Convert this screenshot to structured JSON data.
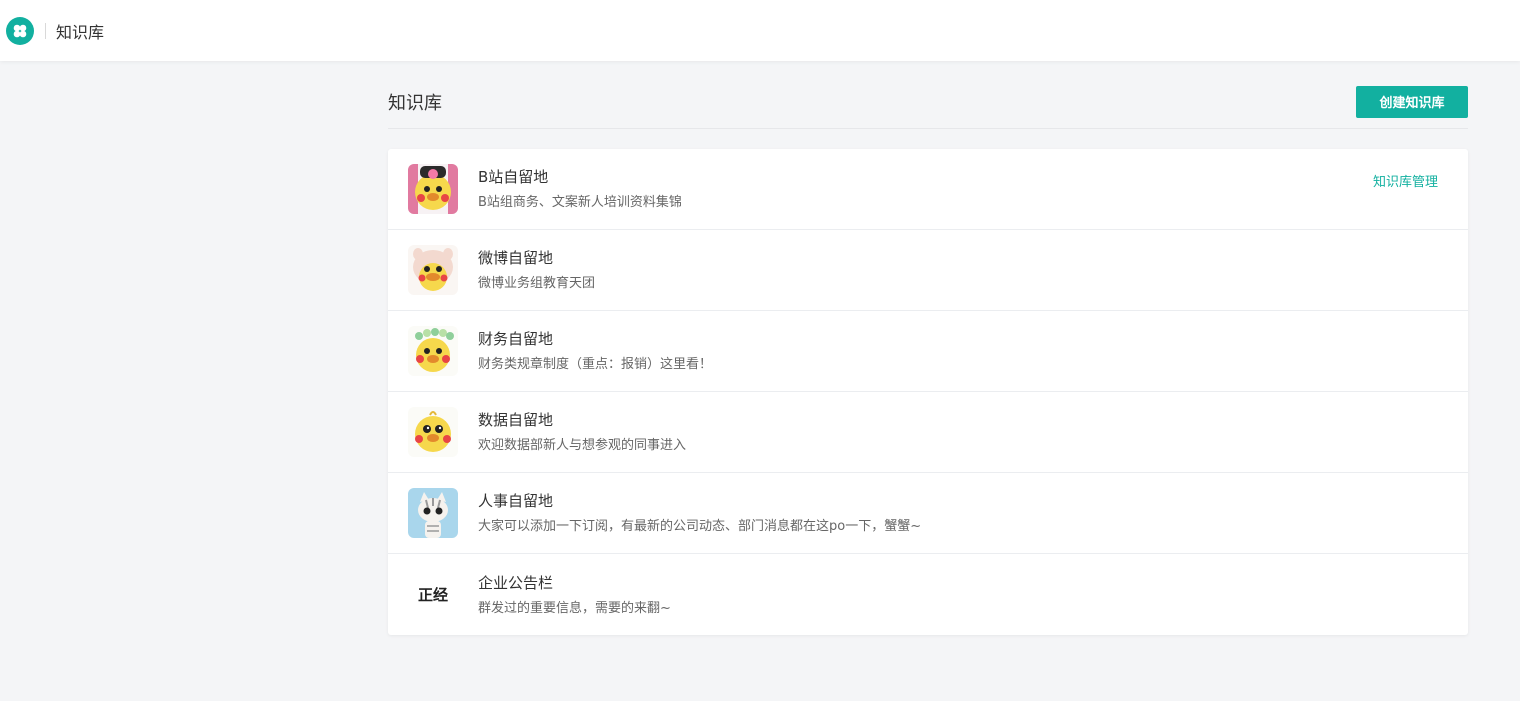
{
  "topbar": {
    "logo_icon": "clover-icon",
    "title": "知识库"
  },
  "page": {
    "title": "知识库",
    "create_button": "创建知识库"
  },
  "colors": {
    "accent": "#12b0a0",
    "background": "#f4f5f7"
  },
  "kb_items": [
    {
      "name": "B站自留地",
      "desc": "B站组商务、文案新人培训资料集锦",
      "avatar": "duck-bow-avatar",
      "manage_label": "知识库管理"
    },
    {
      "name": "微博自留地",
      "desc": "微博业务组教育天团",
      "avatar": "duck-pig-hat-avatar"
    },
    {
      "name": "财务自留地",
      "desc": "财务类规章制度（重点：报销）这里看！",
      "avatar": "duck-flower-crown-avatar"
    },
    {
      "name": "数据自留地",
      "desc": "欢迎数据部新人与想参观的同事进入",
      "avatar": "duck-avatar"
    },
    {
      "name": "人事自留地",
      "desc": "大家可以添加一下订阅，有最新的公司动态、部门消息都在这po一下，蟹蟹~",
      "avatar": "cat-avatar"
    },
    {
      "name": "企业公告栏",
      "desc": "群发过的重要信息，需要的来翻~",
      "avatar_text": "正经"
    }
  ]
}
